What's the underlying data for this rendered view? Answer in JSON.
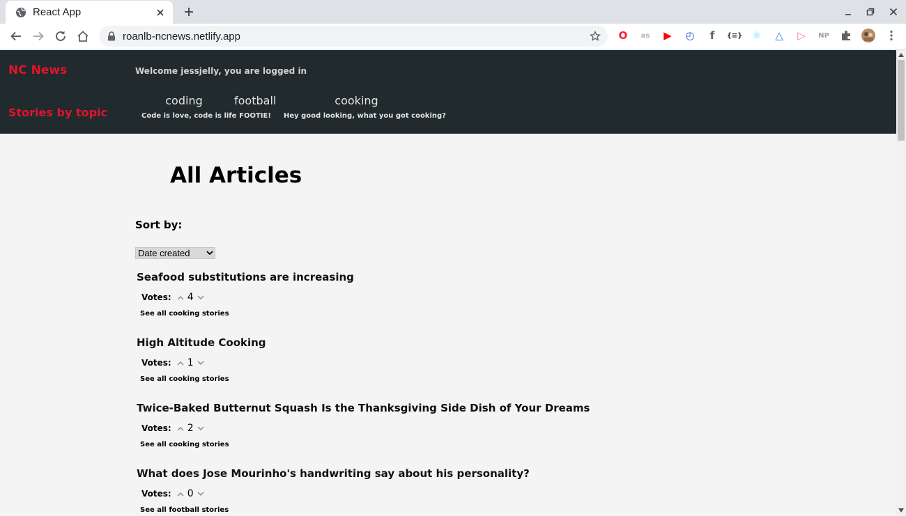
{
  "browser": {
    "tab_title": "React App",
    "url": "roanlb-ncnews.netlify.app",
    "extensions": [
      {
        "name": "opera-icon",
        "glyph": "O",
        "color": "#ff1b2d"
      },
      {
        "name": "lastfm-icon",
        "glyph": "as",
        "color": "#b3b3b3"
      },
      {
        "name": "youtube-icon",
        "glyph": "▶",
        "color": "#ff0000"
      },
      {
        "name": "clock-icon",
        "glyph": "◴",
        "color": "#1e5fc9"
      },
      {
        "name": "facebook-icon",
        "glyph": "f",
        "color": "#5f6368"
      },
      {
        "name": "json-viewer-icon",
        "glyph": "{≡}",
        "color": "#333333"
      },
      {
        "name": "react-devtools-icon",
        "glyph": "⚛",
        "color": "#61dafb"
      },
      {
        "name": "triangle-extension-icon",
        "glyph": "△",
        "color": "#1a73e8"
      },
      {
        "name": "video-extension-icon",
        "glyph": "▷",
        "color": "#f08080"
      },
      {
        "name": "np-extension-icon",
        "glyph": "NP",
        "color": "#9aa0a6"
      }
    ]
  },
  "site": {
    "brand": "NC News",
    "welcome": "Welcome jessjelly, you are logged in",
    "topics_heading": "Stories by topic",
    "topics": [
      {
        "name": "coding",
        "description": "Code is love, code is life"
      },
      {
        "name": "football",
        "description": "FOOTIE!"
      },
      {
        "name": "cooking",
        "description": "Hey good looking, what you got cooking?"
      }
    ]
  },
  "main": {
    "title": "All Articles",
    "sort_label": "Sort by:",
    "sort_selected": "Date created",
    "votes_label": "Votes:",
    "articles": [
      {
        "title": "Seafood substitutions are increasing",
        "votes": "4",
        "link": "See all cooking stories"
      },
      {
        "title": "High Altitude Cooking",
        "votes": "1",
        "link": "See all cooking stories"
      },
      {
        "title": "Twice-Baked Butternut Squash Is the Thanksgiving Side Dish of Your Dreams",
        "votes": "2",
        "link": "See all cooking stories"
      },
      {
        "title": "What does Jose Mourinho's handwriting say about his personality?",
        "votes": "0",
        "link": "See all football stories"
      }
    ]
  },
  "colors": {
    "header_bg": "#212a2c",
    "accent_red": "#e0142e",
    "page_bg": "#f4f4f4"
  }
}
